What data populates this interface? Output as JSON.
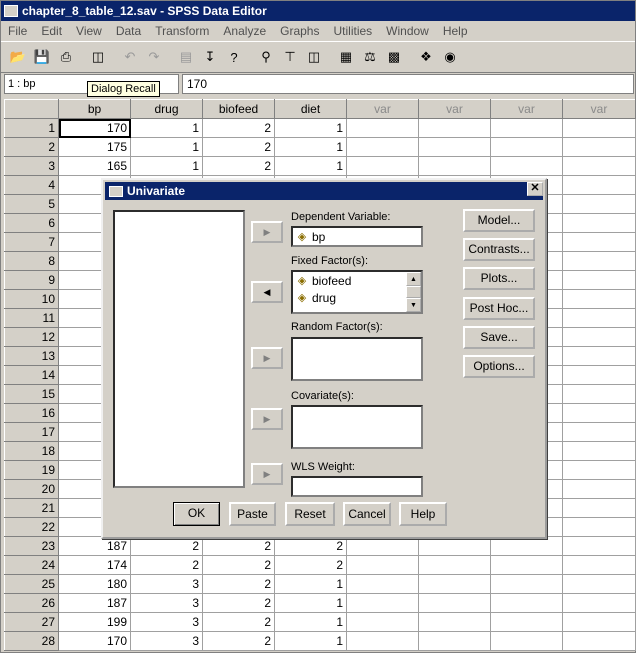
{
  "window": {
    "title": "chapter_8_table_12.sav - SPSS Data Editor"
  },
  "menu": [
    "File",
    "Edit",
    "View",
    "Data",
    "Transform",
    "Analyze",
    "Graphs",
    "Utilities",
    "Window",
    "Help"
  ],
  "toolbar": {
    "icons": [
      "open-icon",
      "save-icon",
      "print-icon",
      "dialog-recall-icon",
      "undo-icon",
      "redo-icon",
      "goto-chart-icon",
      "goto-case-icon",
      "variables-icon",
      "find-icon",
      "insert-cases-icon",
      "insert-variable-icon",
      "split-file-icon",
      "weight-cases-icon",
      "select-cases-icon",
      "value-labels-icon",
      "use-sets-icon"
    ]
  },
  "cellbar": {
    "ref": "1 : bp",
    "value": "170"
  },
  "tooltip": "Dialog Recall",
  "grid": {
    "columns": [
      "bp",
      "drug",
      "biofeed",
      "diet",
      "var",
      "var",
      "var",
      "var"
    ],
    "rows": [
      {
        "n": "1",
        "bp": "170",
        "drug": "1",
        "biofeed": "2",
        "diet": "1"
      },
      {
        "n": "2",
        "bp": "175",
        "drug": "1",
        "biofeed": "2",
        "diet": "1"
      },
      {
        "n": "3",
        "bp": "165",
        "drug": "1",
        "biofeed": "2",
        "diet": "1"
      },
      {
        "n": "4",
        "bp": "",
        "drug": "",
        "biofeed": "",
        "diet": ""
      },
      {
        "n": "5",
        "bp": "",
        "drug": "",
        "biofeed": "",
        "diet": ""
      },
      {
        "n": "6",
        "bp": "",
        "drug": "",
        "biofeed": "",
        "diet": ""
      },
      {
        "n": "7",
        "bp": "",
        "drug": "",
        "biofeed": "",
        "diet": ""
      },
      {
        "n": "8",
        "bp": "",
        "drug": "",
        "biofeed": "",
        "diet": ""
      },
      {
        "n": "9",
        "bp": "",
        "drug": "",
        "biofeed": "",
        "diet": ""
      },
      {
        "n": "10",
        "bp": "",
        "drug": "",
        "biofeed": "",
        "diet": ""
      },
      {
        "n": "11",
        "bp": "",
        "drug": "",
        "biofeed": "",
        "diet": ""
      },
      {
        "n": "12",
        "bp": "",
        "drug": "",
        "biofeed": "",
        "diet": ""
      },
      {
        "n": "13",
        "bp": "",
        "drug": "",
        "biofeed": "",
        "diet": ""
      },
      {
        "n": "14",
        "bp": "",
        "drug": "",
        "biofeed": "",
        "diet": ""
      },
      {
        "n": "15",
        "bp": "",
        "drug": "",
        "biofeed": "",
        "diet": ""
      },
      {
        "n": "16",
        "bp": "",
        "drug": "",
        "biofeed": "",
        "diet": ""
      },
      {
        "n": "17",
        "bp": "",
        "drug": "",
        "biofeed": "",
        "diet": ""
      },
      {
        "n": "18",
        "bp": "",
        "drug": "",
        "biofeed": "",
        "diet": ""
      },
      {
        "n": "19",
        "bp": "",
        "drug": "",
        "biofeed": "",
        "diet": ""
      },
      {
        "n": "20",
        "bp": "",
        "drug": "",
        "biofeed": "",
        "diet": ""
      },
      {
        "n": "21",
        "bp": "",
        "drug": "",
        "biofeed": "",
        "diet": ""
      },
      {
        "n": "22",
        "bp": "",
        "drug": "",
        "biofeed": "",
        "diet": ""
      },
      {
        "n": "23",
        "bp": "187",
        "drug": "2",
        "biofeed": "2",
        "diet": "2"
      },
      {
        "n": "24",
        "bp": "174",
        "drug": "2",
        "biofeed": "2",
        "diet": "2"
      },
      {
        "n": "25",
        "bp": "180",
        "drug": "3",
        "biofeed": "2",
        "diet": "1"
      },
      {
        "n": "26",
        "bp": "187",
        "drug": "3",
        "biofeed": "2",
        "diet": "1"
      },
      {
        "n": "27",
        "bp": "199",
        "drug": "3",
        "biofeed": "2",
        "diet": "1"
      },
      {
        "n": "28",
        "bp": "170",
        "drug": "3",
        "biofeed": "2",
        "diet": "1"
      }
    ]
  },
  "dialog": {
    "title": "Univariate",
    "dependent_label": "Dependent Variable:",
    "dependent_value": "bp",
    "fixed_label": "Fixed Factor(s):",
    "fixed_items": [
      "biofeed",
      "drug"
    ],
    "random_label": "Random Factor(s):",
    "covariate_label": "Covariate(s):",
    "wls_label": "WLS Weight:",
    "side_buttons": [
      "Model...",
      "Contrasts...",
      "Plots...",
      "Post Hoc...",
      "Save...",
      "Options..."
    ],
    "bottom_buttons": [
      "OK",
      "Paste",
      "Reset",
      "Cancel",
      "Help"
    ]
  }
}
